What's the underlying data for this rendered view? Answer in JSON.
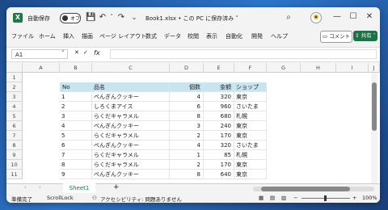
{
  "titlebar": {
    "logo": "X",
    "autosave_label": "自動保存",
    "autosave_state": "オフ",
    "doc_title": "Book1.xlsx • この PC に保存済み ˅",
    "search_icon": "search-icon",
    "minimize": "—",
    "maximize": "☐",
    "close": "✕"
  },
  "menu": {
    "items": [
      "ファイル",
      "ホーム",
      "挿入",
      "描画",
      "ページ レイアウト",
      "数式",
      "データ",
      "校閲",
      "表示",
      "自動化",
      "開発",
      "ヘルプ"
    ],
    "comment_label": "コメント",
    "share_label": "共有 ˅"
  },
  "formula_bar": {
    "name_box": "A1",
    "fx": "fx",
    "formula": ""
  },
  "columns": [
    "A",
    "B",
    "C",
    "D",
    "E",
    "F",
    "G",
    "H",
    "I",
    "J"
  ],
  "rows": [
    "1",
    "2",
    "3",
    "4",
    "5",
    "6",
    "7",
    "8",
    "9",
    "10",
    "11"
  ],
  "table": {
    "headers": [
      "No",
      "品名",
      "個数",
      "金額",
      "ショップ"
    ],
    "rows": [
      [
        "1",
        "ぺんぎんクッキー",
        "4",
        "320",
        "東京"
      ],
      [
        "2",
        "しろくまアイス",
        "6",
        "960",
        "さいたま"
      ],
      [
        "3",
        "らくだキャラメル",
        "8",
        "680",
        "札幌"
      ],
      [
        "4",
        "ぺんぎんクッキー",
        "3",
        "240",
        "東京"
      ],
      [
        "5",
        "らくだキャラメル",
        "2",
        "170",
        "東京"
      ],
      [
        "6",
        "ぺんぎんクッキー",
        "4",
        "320",
        "さいたま"
      ],
      [
        "7",
        "らくだキャラメル",
        "1",
        "85",
        "札幌"
      ],
      [
        "8",
        "らくだキャラメル",
        "2",
        "170",
        "東京"
      ],
      [
        "9",
        "ぺんぎんクッキー",
        "8",
        "640",
        "東京"
      ]
    ]
  },
  "sheets": {
    "active": "Sheet1",
    "add": "+"
  },
  "status": {
    "ready": "準備完了",
    "scroll_lock": "ScrollLock",
    "accessibility": "アクセシビリティ: 問題ありません",
    "zoom": "100%"
  }
}
